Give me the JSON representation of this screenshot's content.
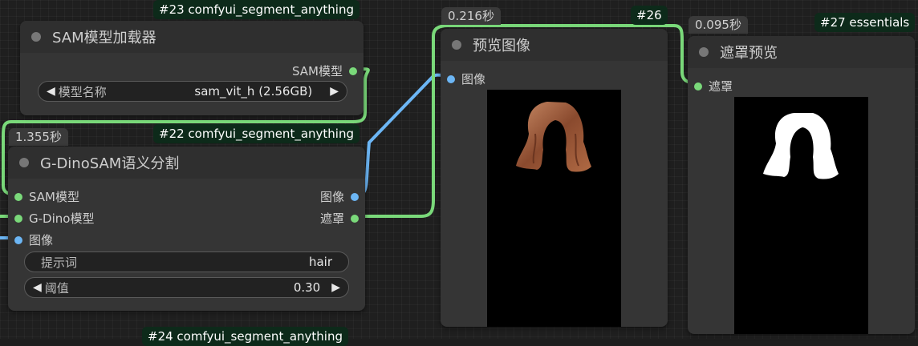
{
  "node23": {
    "tag": "#23 comfyui_segment_anything",
    "title": "SAM模型加载器",
    "output_label": "SAM模型",
    "widget_label": "模型名称",
    "widget_value": "sam_vit_h (2.56GB)"
  },
  "node22": {
    "timing": "1.355秒",
    "tag": "#22 comfyui_segment_anything",
    "title": "G-DinoSAM语义分割",
    "inputs": [
      "SAM模型",
      "G-Dino模型",
      "图像"
    ],
    "outputs": [
      "图像",
      "遮罩"
    ],
    "prompt_label": "提示词",
    "prompt_value": "hair",
    "threshold_label": "阈值",
    "threshold_value": "0.30"
  },
  "node24": {
    "tag": "#24 comfyui_segment_anything"
  },
  "node26": {
    "timing": "0.216秒",
    "tag": "#26",
    "title": "预览图像",
    "input_label": "图像"
  },
  "node27": {
    "timing": "0.095秒",
    "tag": "#27 essentials",
    "title": "遮罩预览",
    "input_label": "遮罩"
  },
  "colors": {
    "sam_wire": "#7ad97a",
    "image_wire": "#6cb6f5",
    "tag_bg": "#0d2a1a"
  },
  "arrows": {
    "left": "◀",
    "right": "▶"
  }
}
